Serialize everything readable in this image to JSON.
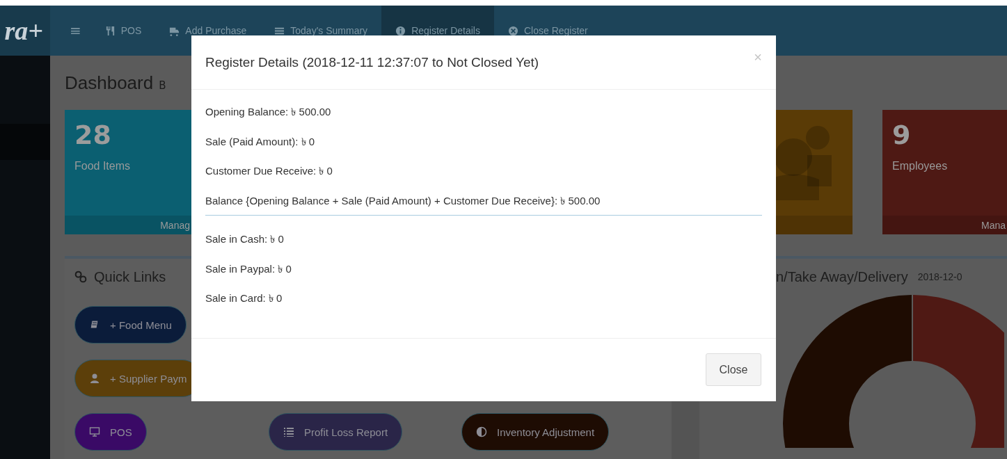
{
  "logo": {
    "text": "ra+"
  },
  "navbar": {
    "menu_glyph": "≡",
    "items": [
      {
        "label": "POS",
        "selected": false
      },
      {
        "label": "Add Purchase",
        "selected": false
      },
      {
        "label": "Today's Summary",
        "selected": false
      },
      {
        "label": "Register Details",
        "selected": true
      },
      {
        "label": "Close Register",
        "selected": false
      }
    ]
  },
  "page": {
    "title": "Dashboard",
    "subtitle": "B"
  },
  "cards": [
    {
      "value": "28",
      "label": "Food Items",
      "footer": "Manag",
      "color": "#0b5f71"
    },
    {
      "color": "#5a3b06"
    },
    {
      "value": "9",
      "label": "Employees",
      "footer": "Mana",
      "color": "#4e1914"
    }
  ],
  "quick_links": {
    "title": "Quick Links",
    "buttons": [
      {
        "label": "+ Food Menu",
        "color": "#0b1c3a"
      },
      {
        "label": "+ Supplier Paym",
        "color": "#5c3f0a"
      },
      {
        "label": "POS",
        "color": "#3a0a66"
      },
      {
        "label": "Profit Loss Report",
        "color": "#2a2548"
      },
      {
        "label": "Inventory Adjustment",
        "color": "#1e0c03"
      }
    ]
  },
  "chart_panel": {
    "title": "n/Take Away/Delivery",
    "date": "2018-12-0"
  },
  "modal": {
    "title": "Register Details (2018-12-11 12:37:07 to Not Closed Yet)",
    "close_glyph": "×",
    "summary_lines": [
      "Opening Balance: ৳ 500.00",
      "Sale (Paid Amount): ৳ 0",
      "Customer Due Receive: ৳ 0",
      "Balance {Opening Balance + Sale (Paid Amount) + Customer Due Receive}: ৳ 500.00"
    ],
    "payment_lines": [
      "Sale in Cash: ৳ 0",
      "Sale in Paypal: ৳ 0",
      "Sale in Card: ৳ 0"
    ],
    "close_button": "Close"
  }
}
